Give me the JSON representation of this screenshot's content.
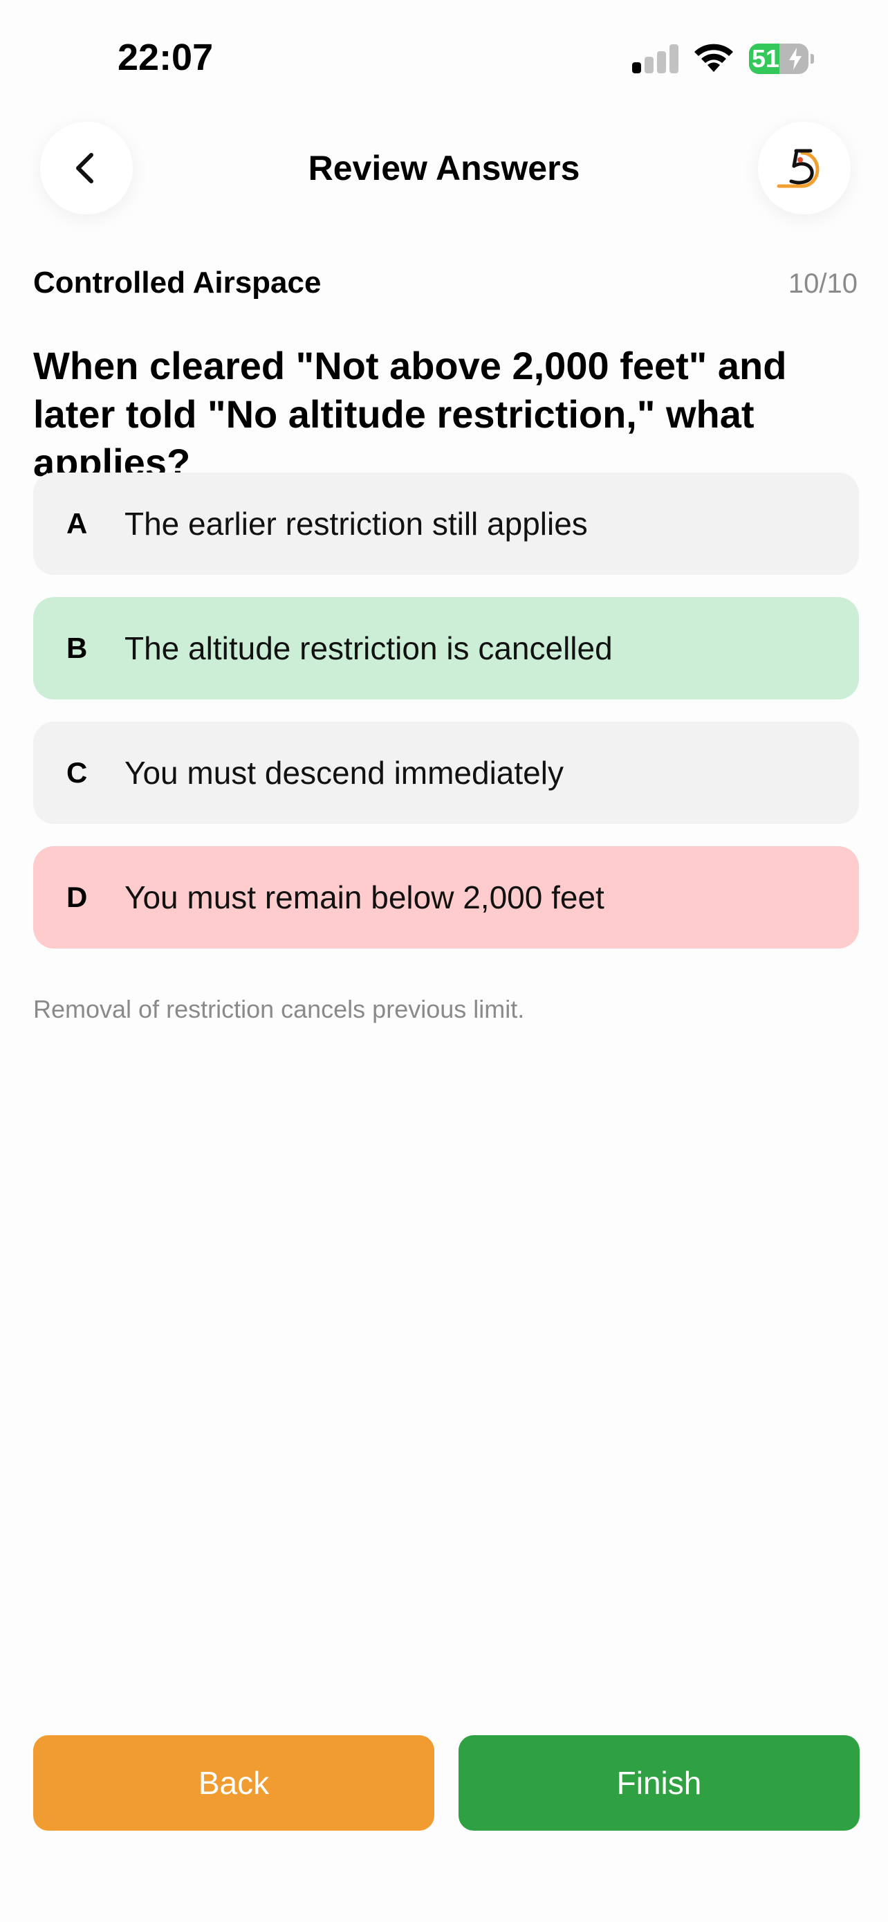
{
  "status_bar": {
    "time": "22:07",
    "battery_level": "51",
    "battery_percent": 51,
    "charging": true,
    "signal_bars_active": 1,
    "signal_bars_total": 4
  },
  "header": {
    "title": "Review Answers",
    "back_icon": "chevron-left-icon",
    "logo_icon": "app-logo-5-icon"
  },
  "quiz": {
    "category": "Controlled Airspace",
    "progress": "10/10",
    "question": "When cleared \"Not above 2,000 feet\" and later told \"No altitude restriction,\" what applies?",
    "options": [
      {
        "letter": "A",
        "text": "The earlier restriction still applies",
        "state": "neutral"
      },
      {
        "letter": "B",
        "text": "The altitude restriction is cancelled",
        "state": "correct"
      },
      {
        "letter": "C",
        "text": "You must descend immediately",
        "state": "neutral"
      },
      {
        "letter": "D",
        "text": "You must remain below 2,000 feet",
        "state": "wrong"
      }
    ],
    "explanation": "Removal of restriction cancels previous limit."
  },
  "actions": {
    "back_label": "Back",
    "finish_label": "Finish"
  },
  "colors": {
    "correct_bg": "#cdeed6",
    "wrong_bg": "#ffcccd",
    "neutral_bg": "#f2f2f2",
    "back_button": "#f09c30",
    "finish_button": "#2fa142",
    "battery_green": "#34c759",
    "logo_orange": "#f0a030"
  }
}
